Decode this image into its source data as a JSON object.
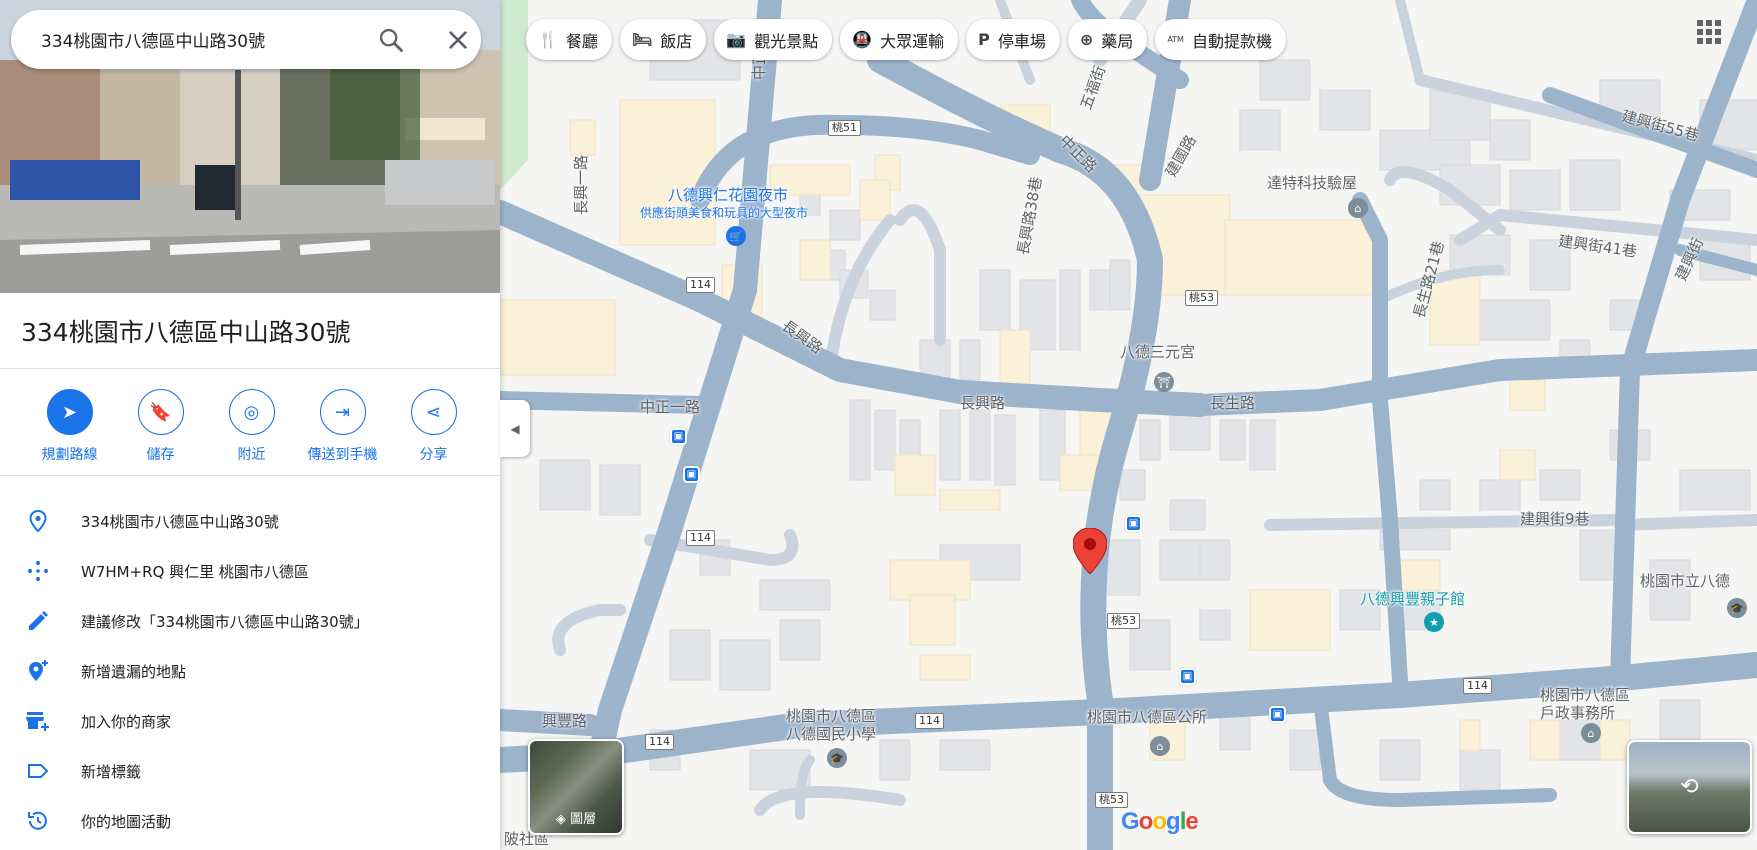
{
  "search": {
    "value": "334桃園市八德區中山路30號"
  },
  "place": {
    "title": "334桃園市八德區中山路30號"
  },
  "actions": [
    {
      "label": "規劃路線",
      "icon": "directions-icon"
    },
    {
      "label": "儲存",
      "icon": "bookmark-icon"
    },
    {
      "label": "附近",
      "icon": "nearby-icon"
    },
    {
      "label": "傳送到手機",
      "icon": "send-to-phone-icon"
    },
    {
      "label": "分享",
      "icon": "share-icon"
    }
  ],
  "info": [
    {
      "text": "334桃園市八德區中山路30號",
      "icon": "location-pin-icon"
    },
    {
      "text": "W7HM+RQ 興仁里 桃園市八德區",
      "icon": "plus-code-icon"
    },
    {
      "text": "建議修改「334桃園市八德區中山路30號」",
      "icon": "edit-icon"
    },
    {
      "text": "新增遺漏的地點",
      "icon": "add-place-icon"
    },
    {
      "text": "加入你的商家",
      "icon": "add-business-icon"
    },
    {
      "text": "新增標籤",
      "icon": "label-icon"
    },
    {
      "text": "你的地圖活動",
      "icon": "history-icon"
    }
  ],
  "chips": [
    {
      "label": "餐廳",
      "icon": "restaurant-icon"
    },
    {
      "label": "飯店",
      "icon": "hotel-icon"
    },
    {
      "label": "觀光景點",
      "icon": "camera-icon"
    },
    {
      "label": "大眾運輸",
      "icon": "transit-icon"
    },
    {
      "label": "停車場",
      "icon": "parking-icon"
    },
    {
      "label": "藥局",
      "icon": "pharmacy-icon"
    },
    {
      "label": "自動提款機",
      "icon": "atm-icon"
    }
  ],
  "layers_label": "圖層",
  "map": {
    "roads": {
      "zhongzheng": "中正路",
      "zhongzheng_n": "中正北路",
      "zhongzheng1": "中正一路",
      "jianguo": "建國路",
      "changxing": "長興路",
      "changxing_e": "長興路",
      "changsheng": "長生路",
      "changxing_st38": "長興路38巷",
      "changsheng_ln21": "長生路21巷",
      "jianxing55": "建興街55巷",
      "jianxing41": "建興街41巷",
      "jianxing9": "建興街9巷",
      "jianxing": "建興街",
      "xingfeng": "興豐路",
      "changxing1": "長興一路",
      "wufu": "五福街"
    },
    "shields": {
      "t51": "桃51",
      "t53a": "桃53",
      "t53b": "桃53",
      "t53c": "桃53",
      "r114a": "114",
      "r114b": "114",
      "r114c": "114",
      "r114d": "114",
      "r114e": "114"
    },
    "pois": {
      "nightmarket": "八德興仁花園夜市",
      "nightmarket_sub": "供應街頭美食和玩具的大型夜市",
      "dater": "達特科技驗屋",
      "sanyuan": "八德三元宮",
      "xingfeng_kids": "八德興豐親子館",
      "school": "桃園市八德區\n八德國民小學",
      "district_office": "桃園市八德區公所",
      "household": "桃園市八德區\n戶政事務所",
      "taoyuan_school": "桃園市立八德",
      "community": "陂社區"
    }
  },
  "google_logo": "Google",
  "colors": {
    "accent": "#1a73e8",
    "pin": "#ea4335"
  }
}
